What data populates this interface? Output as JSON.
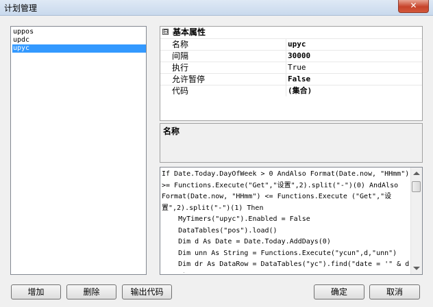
{
  "window": {
    "title": "计划管理",
    "close_glyph": "✕"
  },
  "plan_list": {
    "items": [
      {
        "label": "uppos",
        "selected": false
      },
      {
        "label": "updc",
        "selected": false
      },
      {
        "label": "upyc",
        "selected": true
      }
    ]
  },
  "property_grid": {
    "category": {
      "label": "基本属性",
      "toggle": "⊟"
    },
    "rows": [
      {
        "name": "名称",
        "value": "upyc"
      },
      {
        "name": "间隔",
        "value": "30000"
      },
      {
        "name": "执行",
        "value": "True"
      },
      {
        "name": "允许暂停",
        "value": "False"
      },
      {
        "name": "代码",
        "value": "(集合)"
      }
    ]
  },
  "description": {
    "title": "名称"
  },
  "code": {
    "lines": [
      "If Date.Today.DayOfWeek > 0 AndAlso Format(Date.now, \"HHmm\")",
      ">= Functions.Execute(\"Get\",\"设置\",2).split(\"-\")(0) AndAlso",
      "Format(Date.now, \"HHmm\") <= Functions.Execute (\"Get\",\"设",
      "置\",2).split(\"-\")(1) Then",
      "    MyTimers(\"upyc\").Enabled = False",
      "    DataTables(\"pos\").load()",
      "    Dim d As Date = Date.Today.AddDays(0)",
      "    Dim unn As String = Functions.Execute(\"ycun\",d,\"unn\")",
      "    Dim dr As DataRow = DataTables(\"yc\").find(\"date = '\" & d",
      "& \"'\")"
    ]
  },
  "buttons": {
    "add": "增加",
    "delete": "删除",
    "export": "输出代码",
    "ok": "确定",
    "cancel": "取消"
  }
}
